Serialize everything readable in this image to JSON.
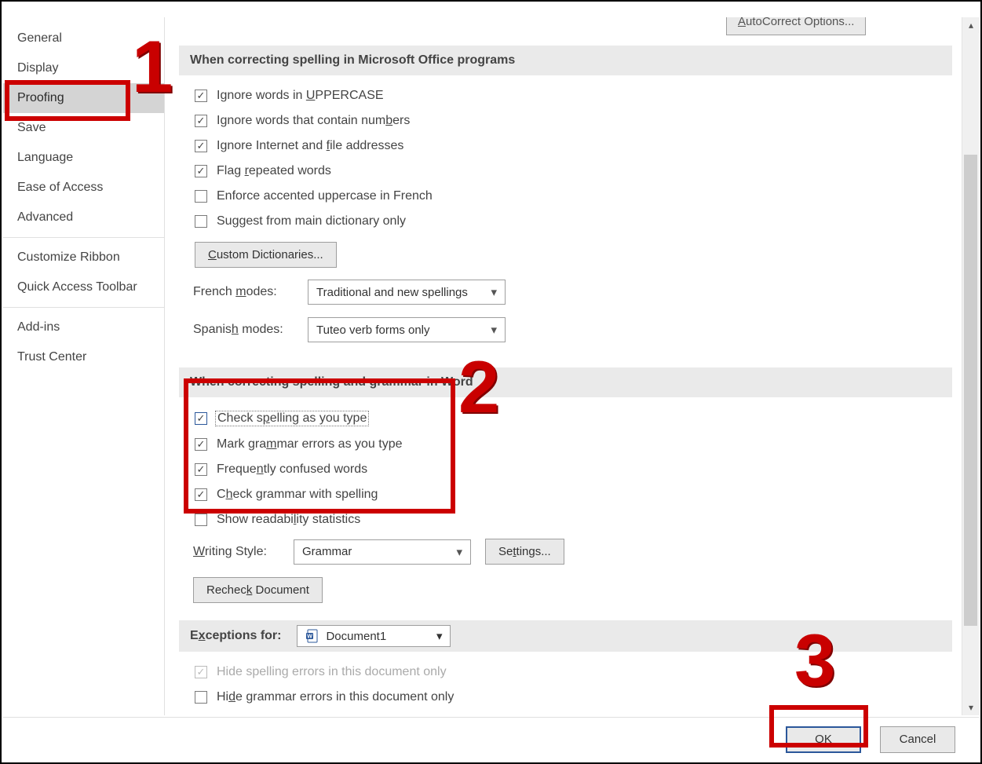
{
  "sidebar": {
    "items": [
      {
        "label": "General"
      },
      {
        "label": "Display"
      },
      {
        "label": "Proofing",
        "selected": true
      },
      {
        "label": "Save"
      },
      {
        "label": "Language"
      },
      {
        "label": "Ease of Access"
      },
      {
        "label": "Advanced"
      }
    ],
    "items2": [
      {
        "label": "Customize Ribbon"
      },
      {
        "label": "Quick Access Toolbar"
      }
    ],
    "items3": [
      {
        "label": "Add-ins"
      },
      {
        "label": "Trust Center"
      }
    ]
  },
  "top": {
    "autocorrect_button": "AutoCorrect Options..."
  },
  "section1": {
    "heading": "When correcting spelling in Microsoft Office programs",
    "opts": {
      "uppercase": "Ignore words in UPPERCASE",
      "numbers": "Ignore words that contain numbers",
      "internet": "Ignore Internet and file addresses",
      "repeated": "Flag repeated words",
      "french_acc": "Enforce accented uppercase in French",
      "main_dict": "Suggest from main dictionary only"
    },
    "custom_dict_btn": "Custom Dictionaries...",
    "french_label": "French modes:",
    "french_value": "Traditional and new spellings",
    "spanish_label": "Spanish modes:",
    "spanish_value": "Tuteo verb forms only"
  },
  "section2": {
    "heading": "When correcting spelling and grammar in Word",
    "opts": {
      "spell_type": "Check spelling as you type",
      "grammar_type": "Mark grammar errors as you type",
      "confused": "Frequently confused words",
      "grammar_spell": "Check grammar with spelling",
      "readability": "Show readability statistics"
    },
    "writing_style_label": "Writing Style:",
    "writing_style_value": "Grammar",
    "settings_btn": "Settings...",
    "recheck_btn": "Recheck Document"
  },
  "section3": {
    "heading": "Exceptions for:",
    "doc_value": "Document1",
    "opts": {
      "hide_spell": "Hide spelling errors in this document only",
      "hide_grammar": "Hide grammar errors in this document only"
    }
  },
  "footer": {
    "ok": "OK",
    "cancel": "Cancel"
  },
  "annotations": {
    "one": "1",
    "two": "2",
    "three": "3"
  }
}
